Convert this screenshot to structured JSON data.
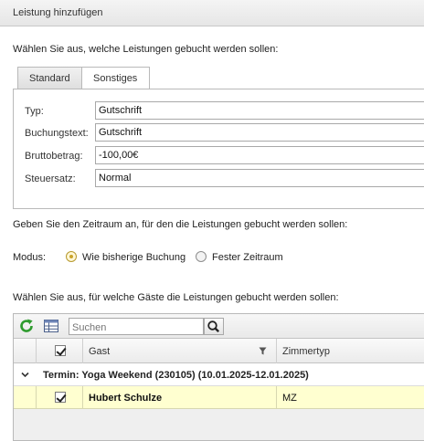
{
  "dialog": {
    "title": "Leistung hinzufügen"
  },
  "services": {
    "prompt": "Wählen Sie aus, welche Leistungen gebucht werden sollen:",
    "tabs": [
      {
        "label": "Standard",
        "active": false
      },
      {
        "label": "Sonstiges",
        "active": true
      }
    ],
    "fields": [
      {
        "label": "Typ:",
        "value": "Gutschrift"
      },
      {
        "label": "Buchungstext:",
        "value": "Gutschrift"
      },
      {
        "label": "Bruttobetrag:",
        "value": "-100,00€"
      },
      {
        "label": "Steuersatz:",
        "value": "Normal"
      }
    ]
  },
  "period": {
    "prompt": "Geben Sie den Zeitraum an, für den die Leistungen gebucht werden sollen:",
    "mode_label": "Modus:",
    "options": [
      {
        "label": "Wie bisherige Buchung",
        "selected": true
      },
      {
        "label": "Fester Zeitraum",
        "selected": false
      }
    ]
  },
  "guests": {
    "prompt": "Wählen Sie aus, für welche Gäste die Leistungen gebucht werden sollen:",
    "search_placeholder": "Suchen",
    "columns": {
      "guest": "Gast",
      "room_type": "Zimmertyp"
    },
    "header_checked": true,
    "group": {
      "label": "Termin: Yoga Weekend (230105) (10.01.2025-12.01.2025)",
      "expanded": true
    },
    "rows": [
      {
        "checked": true,
        "guest": "Hubert Schulze",
        "room_type": "MZ"
      }
    ]
  },
  "colors": {
    "selected_row": "#ffffd0",
    "radio_selected": "#caa42b",
    "refresh_icon": "#2e9b2e"
  },
  "icons": [
    "refresh-icon",
    "grid-settings-icon",
    "search-icon",
    "filter-icon",
    "chevron-down-icon",
    "checkbox-icon"
  ]
}
